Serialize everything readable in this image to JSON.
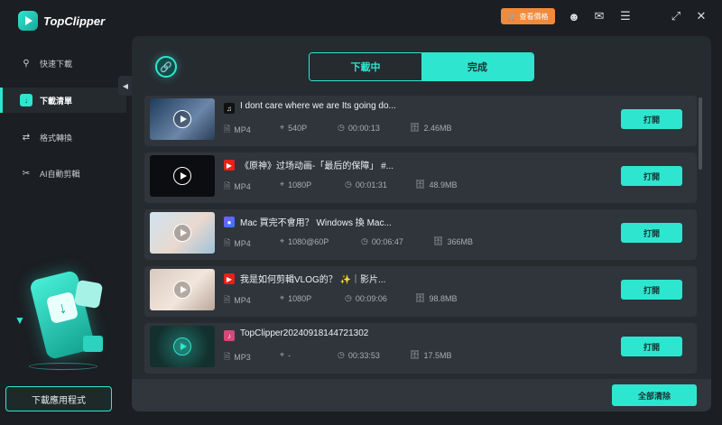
{
  "app": {
    "name": "TopClipper",
    "vip_label": "查看價格",
    "colors": {
      "accent": "#2ee6d0",
      "vip": "#f08a3c",
      "background": "#1b1e22",
      "panel": "#262b30"
    }
  },
  "titlebar": {
    "icons": [
      "cart-icon",
      "user-icon",
      "mail-icon",
      "menu-icon",
      "restore-icon",
      "close-icon"
    ]
  },
  "sidebar": {
    "items": [
      {
        "label": "快速下載",
        "icon": "search-icon",
        "active": false
      },
      {
        "label": "下載清單",
        "icon": "download-list-icon",
        "active": true
      },
      {
        "label": "格式轉換",
        "icon": "convert-icon",
        "active": false
      },
      {
        "label": "AI自動剪輯",
        "icon": "ai-clip-icon",
        "active": false
      }
    ],
    "download_app_label": "下載應用程式"
  },
  "main": {
    "tabs": [
      {
        "label": "下載中",
        "active": false
      },
      {
        "label": "完成",
        "active": true
      }
    ],
    "open_label": "打開",
    "clear_all_label": "全部清除",
    "items": [
      {
        "source": "tiktok",
        "title": "I dont care where we are Its going do...",
        "format": "MP4",
        "resolution": "540P",
        "duration": "00:00:13",
        "size": "2.46MB"
      },
      {
        "source": "youtube",
        "title": "《原神》过场动画-「最后的保障」 #...",
        "format": "MP4",
        "resolution": "1080P",
        "duration": "00:01:31",
        "size": "48.9MB"
      },
      {
        "source": "instagram",
        "title": "Mac 買完不會用？ Windows 換 Mac...",
        "format": "MP4",
        "resolution": "1080@60P",
        "duration": "00:06:47",
        "size": "366MB"
      },
      {
        "source": "youtube",
        "title": "我是如何剪輯VLOG的？ ✨｜影片...",
        "format": "MP4",
        "resolution": "1080P",
        "duration": "00:09:06",
        "size": "98.8MB"
      },
      {
        "source": "music",
        "title": "TopClipper20240918144721302",
        "format": "MP3",
        "resolution": "-",
        "duration": "00:33:53",
        "size": "17.5MB"
      }
    ]
  }
}
